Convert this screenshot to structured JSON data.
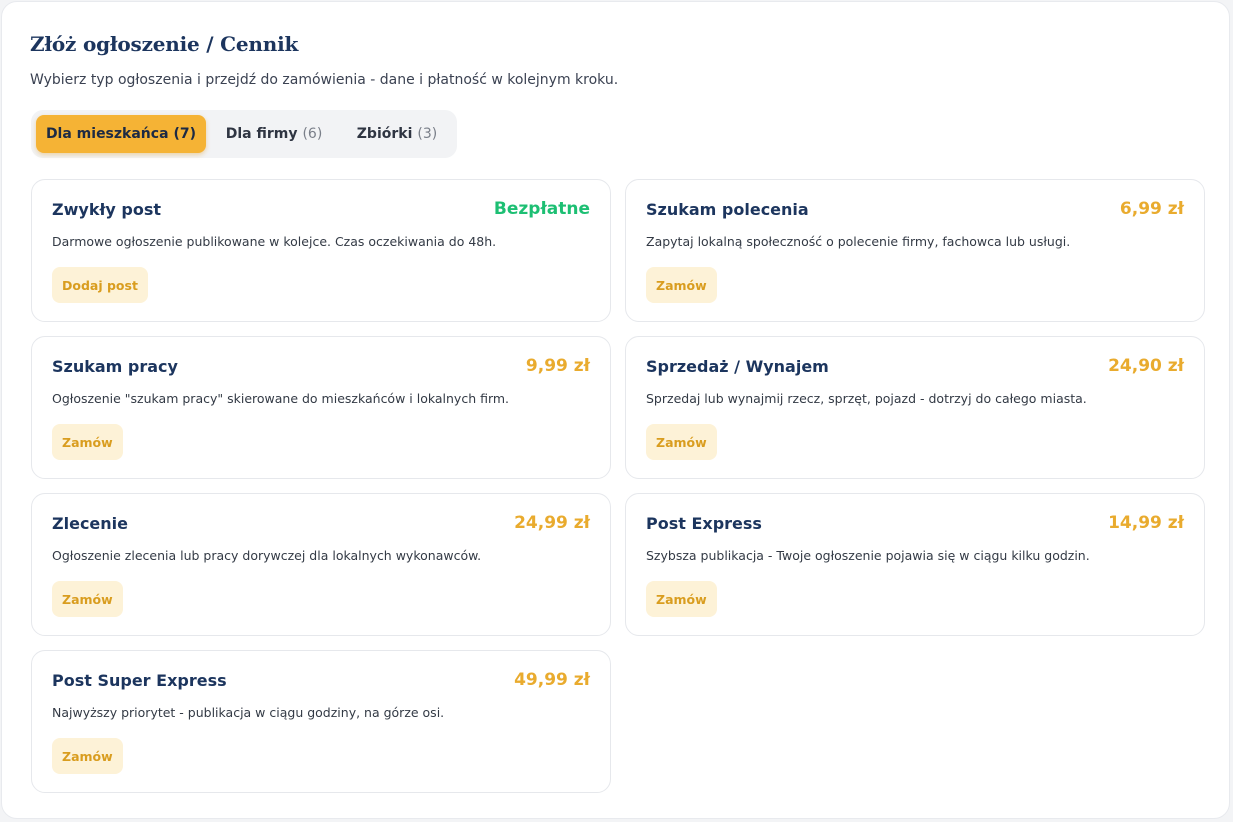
{
  "header": {
    "title": "Złóż ogłoszenie / Cennik",
    "subtitle": "Wybierz typ ogłoszenia i przejdź do zamówienia - dane i płatność w kolejnym kroku."
  },
  "tabs": [
    {
      "label": "Dla mieszkańca",
      "count": "(7)",
      "active": true
    },
    {
      "label": "Dla firmy",
      "count": "(6)",
      "active": false
    },
    {
      "label": "Zbiórki",
      "count": "(3)",
      "active": false
    }
  ],
  "cards": [
    {
      "title": "Zwykły post",
      "price": "Bezpłatne",
      "description": "Darmowe ogłoszenie publikowane w kolejce. Czas oczekiwania do 48h.",
      "button": "Dodaj post"
    },
    {
      "title": "Szukam polecenia",
      "price": "6,99 zł",
      "description": "Zapytaj lokalną społeczność o polecenie firmy, fachowca lub usługi.",
      "button": "Zamów"
    },
    {
      "title": "Szukam pracy",
      "price": "9,99 zł",
      "description": "Ogłoszenie \"szukam pracy\" skierowane do mieszkańców i lokalnych firm.",
      "button": "Zamów"
    },
    {
      "title": "Sprzedaż / Wynajem",
      "price": "24,90 zł",
      "description": "Sprzedaj lub wynajmij rzecz, sprzęt, pojazd - dotrzyj do całego miasta.",
      "button": "Zamów"
    },
    {
      "title": "Zlecenie",
      "price": "24,99 zł",
      "description": "Ogłoszenie zlecenia lub pracy dorywczej dla lokalnych wykonawców.",
      "button": "Zamów"
    },
    {
      "title": "Post Express",
      "price": "14,99 zł",
      "description": "Szybsza publikacja - Twoje ogłoszenie pojawia się w ciągu kilku godzin.",
      "button": "Zamów"
    },
    {
      "title": "Post Super Express",
      "price": "49,99 zł",
      "description": "Najwyższy priorytet - publikacja w ciągu godziny, na górze osi.",
      "button": "Zamów"
    }
  ],
  "colors": {
    "accent": "#f5b335",
    "price": "#e9ab2e",
    "free": "#1dbf73",
    "title": "#1c355e",
    "button_bg": "#fdf2d7",
    "button_text": "#d99d1f"
  }
}
